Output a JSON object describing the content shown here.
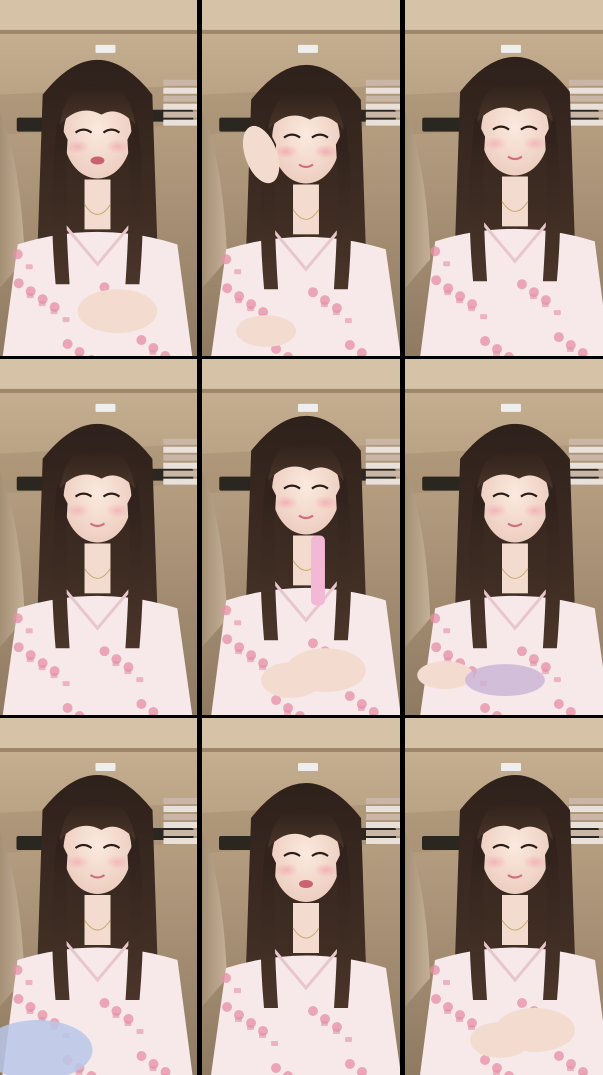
{
  "grid": {
    "rows": 3,
    "cols": 3,
    "frames": [
      {
        "pose": "talking",
        "hand": "right-front",
        "blush": 0.55
      },
      {
        "pose": "hand-at-cheek",
        "hand": "left-up",
        "blush": 0.65
      },
      {
        "pose": "looking-down",
        "hand": "none",
        "blush": 0.5
      },
      {
        "pose": "neutral",
        "hand": "none",
        "blush": 0.5
      },
      {
        "pose": "holding-item",
        "hand": "both-front",
        "blush": 0.6
      },
      {
        "pose": "smiling",
        "hand": "left-low",
        "blush": 0.55
      },
      {
        "pose": "smiling",
        "hand": "blanket",
        "blush": 0.5
      },
      {
        "pose": "talking",
        "hand": "none",
        "blush": 0.6
      },
      {
        "pose": "smiling",
        "hand": "both-front",
        "blush": 0.55
      }
    ]
  },
  "colors": {
    "wall": "#b9a489",
    "ceiling": "#d6c2a7",
    "shelf_dark": "#2a2620",
    "hair": "#3a2a22",
    "skin": "#f3dccf",
    "pajama": "#f7e9ea",
    "pajama_print": "#e58fa6"
  }
}
